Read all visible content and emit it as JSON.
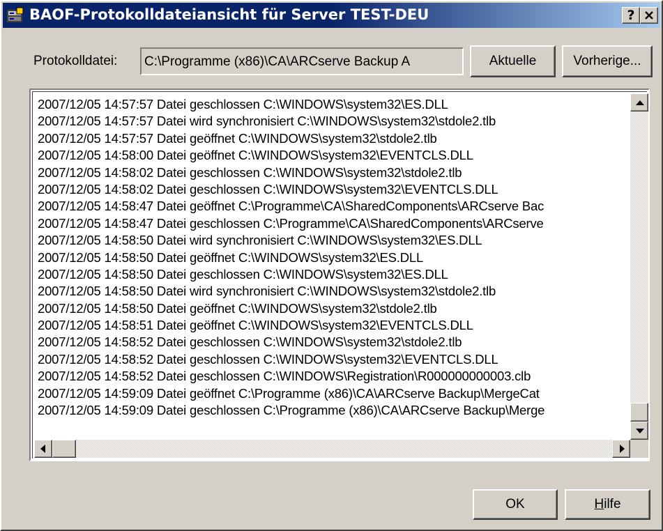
{
  "window": {
    "title": "BAOF-Protokolldateiansicht für Server TEST-DEU",
    "help_button": "?",
    "close_button": "✕"
  },
  "toolbar": {
    "file_label": "Protokolldatei:",
    "file_value": "C:\\Programme (x86)\\CA\\ARCserve Backup A",
    "current_button": "Aktuelle",
    "previous_button": "Vorherige..."
  },
  "log": {
    "lines": [
      "2007/12/05 14:57:57 Datei geschlossen C:\\WINDOWS\\system32\\ES.DLL",
      "2007/12/05 14:57:57 Datei wird synchronisiert C:\\WINDOWS\\system32\\stdole2.tlb",
      "2007/12/05 14:57:57 Datei geöffnet C:\\WINDOWS\\system32\\stdole2.tlb",
      "2007/12/05 14:58:00 Datei geöffnet C:\\WINDOWS\\system32\\EVENTCLS.DLL",
      "2007/12/05 14:58:02 Datei geschlossen C:\\WINDOWS\\system32\\stdole2.tlb",
      "2007/12/05 14:58:02 Datei geschlossen C:\\WINDOWS\\system32\\EVENTCLS.DLL",
      "2007/12/05 14:58:47 Datei geöffnet C:\\Programme\\CA\\SharedComponents\\ARCserve Bac",
      "2007/12/05 14:58:47 Datei geschlossen C:\\Programme\\CA\\SharedComponents\\ARCserve",
      "2007/12/05 14:58:50 Datei wird synchronisiert C:\\WINDOWS\\system32\\ES.DLL",
      "2007/12/05 14:58:50 Datei geöffnet C:\\WINDOWS\\system32\\ES.DLL",
      "2007/12/05 14:58:50 Datei geschlossen C:\\WINDOWS\\system32\\ES.DLL",
      "2007/12/05 14:58:50 Datei wird synchronisiert C:\\WINDOWS\\system32\\stdole2.tlb",
      "2007/12/05 14:58:50 Datei geöffnet C:\\WINDOWS\\system32\\stdole2.tlb",
      "2007/12/05 14:58:51 Datei geöffnet C:\\WINDOWS\\system32\\EVENTCLS.DLL",
      "2007/12/05 14:58:52 Datei geschlossen C:\\WINDOWS\\system32\\stdole2.tlb",
      "2007/12/05 14:58:52 Datei geschlossen C:\\WINDOWS\\system32\\EVENTCLS.DLL",
      "2007/12/05 14:58:52 Datei geschlossen C:\\WINDOWS\\Registration\\R000000000003.clb",
      "2007/12/05 14:59:09 Datei geöffnet C:\\Programme (x86)\\CA\\ARCserve Backup\\MergeCat",
      "2007/12/05 14:59:09 Datei geschlossen C:\\Programme (x86)\\CA\\ARCserve Backup\\Merge"
    ]
  },
  "footer": {
    "ok_button": "OK",
    "help_button_hotkey": "H",
    "help_button_rest": "ilfe"
  },
  "colors": {
    "titlebar_start": "#0a246a",
    "titlebar_end": "#a6caf0",
    "face": "#d4d0c8"
  },
  "icons": [
    "app-icon",
    "help-icon",
    "close-icon",
    "scroll-up-icon",
    "scroll-down-icon",
    "scroll-left-icon",
    "scroll-right-icon"
  ]
}
